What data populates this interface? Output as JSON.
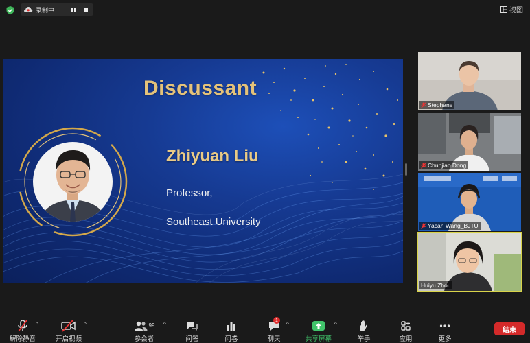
{
  "topbar": {
    "recording_label": "录制中...",
    "view_label": "视图"
  },
  "slide": {
    "title": "Discussant",
    "name": "Zhiyuan Liu",
    "role": "Professor,",
    "organization": "Southeast University"
  },
  "participants": [
    {
      "name": "Stephane"
    },
    {
      "name": "Chunjiao Dong"
    },
    {
      "name": "Yacan Wang_BJTU"
    },
    {
      "name": "Huiyu Zhou"
    }
  ],
  "toolbar": {
    "unmute": "解除静音",
    "start_video": "开启视频",
    "participants": "参会者",
    "participants_count": "99",
    "qa": "问答",
    "polls": "问卷",
    "chat": "聊天",
    "chat_badge": "1",
    "share_screen": "共享屏幕",
    "raise_hand": "举手",
    "apps": "应用",
    "more": "更多",
    "end": "结束"
  },
  "colors": {
    "share_green": "#41c46b",
    "end_red": "#d42a2a",
    "slide_gold": "#e4c27a",
    "active_border": "#d9d44a"
  }
}
